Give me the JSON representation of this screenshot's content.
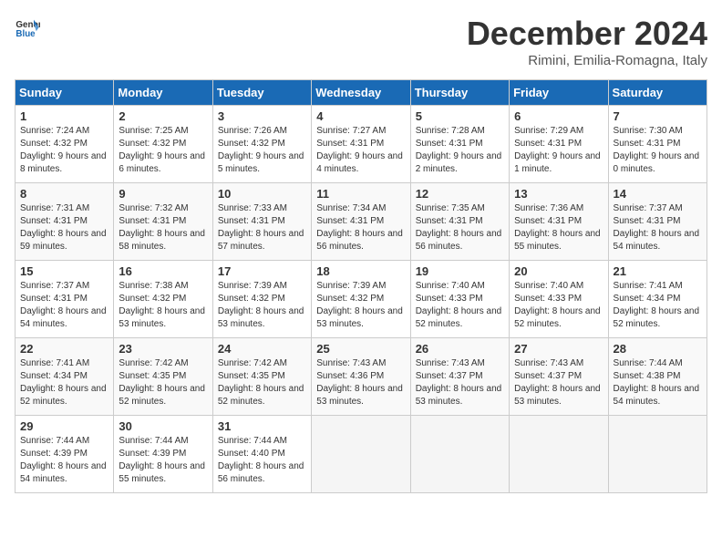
{
  "header": {
    "logo_general": "General",
    "logo_blue": "Blue",
    "month_title": "December 2024",
    "subtitle": "Rimini, Emilia-Romagna, Italy"
  },
  "days_of_week": [
    "Sunday",
    "Monday",
    "Tuesday",
    "Wednesday",
    "Thursday",
    "Friday",
    "Saturday"
  ],
  "weeks": [
    [
      {
        "day": "1",
        "sunrise": "7:24 AM",
        "sunset": "4:32 PM",
        "daylight": "9 hours and 8 minutes."
      },
      {
        "day": "2",
        "sunrise": "7:25 AM",
        "sunset": "4:32 PM",
        "daylight": "9 hours and 6 minutes."
      },
      {
        "day": "3",
        "sunrise": "7:26 AM",
        "sunset": "4:32 PM",
        "daylight": "9 hours and 5 minutes."
      },
      {
        "day": "4",
        "sunrise": "7:27 AM",
        "sunset": "4:31 PM",
        "daylight": "9 hours and 4 minutes."
      },
      {
        "day": "5",
        "sunrise": "7:28 AM",
        "sunset": "4:31 PM",
        "daylight": "9 hours and 2 minutes."
      },
      {
        "day": "6",
        "sunrise": "7:29 AM",
        "sunset": "4:31 PM",
        "daylight": "9 hours and 1 minute."
      },
      {
        "day": "7",
        "sunrise": "7:30 AM",
        "sunset": "4:31 PM",
        "daylight": "9 hours and 0 minutes."
      }
    ],
    [
      {
        "day": "8",
        "sunrise": "7:31 AM",
        "sunset": "4:31 PM",
        "daylight": "8 hours and 59 minutes."
      },
      {
        "day": "9",
        "sunrise": "7:32 AM",
        "sunset": "4:31 PM",
        "daylight": "8 hours and 58 minutes."
      },
      {
        "day": "10",
        "sunrise": "7:33 AM",
        "sunset": "4:31 PM",
        "daylight": "8 hours and 57 minutes."
      },
      {
        "day": "11",
        "sunrise": "7:34 AM",
        "sunset": "4:31 PM",
        "daylight": "8 hours and 56 minutes."
      },
      {
        "day": "12",
        "sunrise": "7:35 AM",
        "sunset": "4:31 PM",
        "daylight": "8 hours and 56 minutes."
      },
      {
        "day": "13",
        "sunrise": "7:36 AM",
        "sunset": "4:31 PM",
        "daylight": "8 hours and 55 minutes."
      },
      {
        "day": "14",
        "sunrise": "7:37 AM",
        "sunset": "4:31 PM",
        "daylight": "8 hours and 54 minutes."
      }
    ],
    [
      {
        "day": "15",
        "sunrise": "7:37 AM",
        "sunset": "4:31 PM",
        "daylight": "8 hours and 54 minutes."
      },
      {
        "day": "16",
        "sunrise": "7:38 AM",
        "sunset": "4:32 PM",
        "daylight": "8 hours and 53 minutes."
      },
      {
        "day": "17",
        "sunrise": "7:39 AM",
        "sunset": "4:32 PM",
        "daylight": "8 hours and 53 minutes."
      },
      {
        "day": "18",
        "sunrise": "7:39 AM",
        "sunset": "4:32 PM",
        "daylight": "8 hours and 53 minutes."
      },
      {
        "day": "19",
        "sunrise": "7:40 AM",
        "sunset": "4:33 PM",
        "daylight": "8 hours and 52 minutes."
      },
      {
        "day": "20",
        "sunrise": "7:40 AM",
        "sunset": "4:33 PM",
        "daylight": "8 hours and 52 minutes."
      },
      {
        "day": "21",
        "sunrise": "7:41 AM",
        "sunset": "4:34 PM",
        "daylight": "8 hours and 52 minutes."
      }
    ],
    [
      {
        "day": "22",
        "sunrise": "7:41 AM",
        "sunset": "4:34 PM",
        "daylight": "8 hours and 52 minutes."
      },
      {
        "day": "23",
        "sunrise": "7:42 AM",
        "sunset": "4:35 PM",
        "daylight": "8 hours and 52 minutes."
      },
      {
        "day": "24",
        "sunrise": "7:42 AM",
        "sunset": "4:35 PM",
        "daylight": "8 hours and 52 minutes."
      },
      {
        "day": "25",
        "sunrise": "7:43 AM",
        "sunset": "4:36 PM",
        "daylight": "8 hours and 53 minutes."
      },
      {
        "day": "26",
        "sunrise": "7:43 AM",
        "sunset": "4:37 PM",
        "daylight": "8 hours and 53 minutes."
      },
      {
        "day": "27",
        "sunrise": "7:43 AM",
        "sunset": "4:37 PM",
        "daylight": "8 hours and 53 minutes."
      },
      {
        "day": "28",
        "sunrise": "7:44 AM",
        "sunset": "4:38 PM",
        "daylight": "8 hours and 54 minutes."
      }
    ],
    [
      {
        "day": "29",
        "sunrise": "7:44 AM",
        "sunset": "4:39 PM",
        "daylight": "8 hours and 54 minutes."
      },
      {
        "day": "30",
        "sunrise": "7:44 AM",
        "sunset": "4:39 PM",
        "daylight": "8 hours and 55 minutes."
      },
      {
        "day": "31",
        "sunrise": "7:44 AM",
        "sunset": "4:40 PM",
        "daylight": "8 hours and 56 minutes."
      },
      null,
      null,
      null,
      null
    ]
  ]
}
